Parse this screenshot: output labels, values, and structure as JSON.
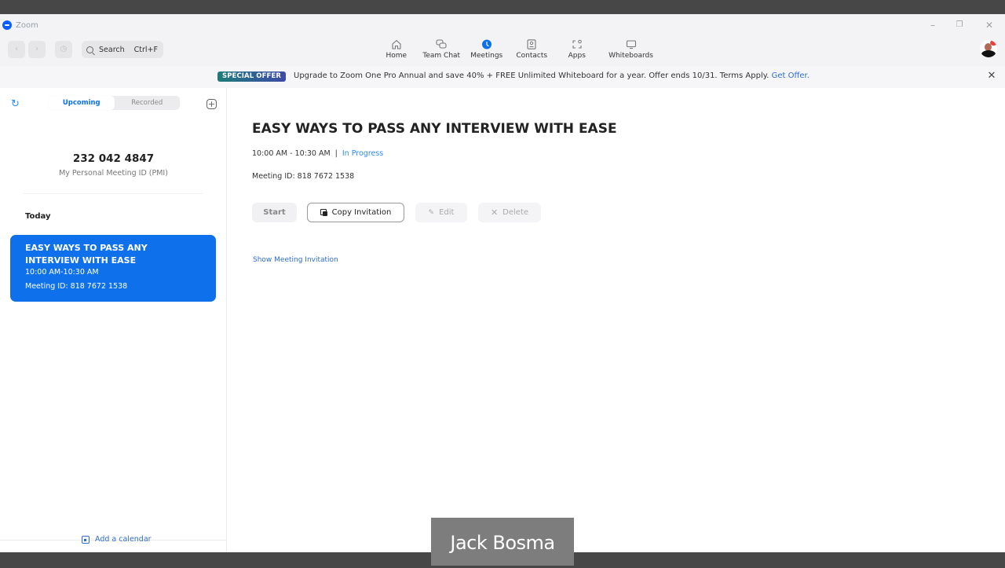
{
  "window": {
    "title": "Zoom",
    "controls": {
      "minimize": "–",
      "restore": "❐",
      "close": "✕"
    }
  },
  "toolbar": {
    "back_icon": "‹",
    "forward_icon": "›",
    "history_icon": "◷",
    "search_label": "Search",
    "search_shortcut": "Ctrl+F"
  },
  "nav": {
    "items": [
      {
        "label": "Home",
        "icon": "home-icon",
        "active": false
      },
      {
        "label": "Team Chat",
        "icon": "chat-icon",
        "active": false
      },
      {
        "label": "Meetings",
        "icon": "clock-icon",
        "active": true
      },
      {
        "label": "Contacts",
        "icon": "contacts-icon",
        "active": false
      },
      {
        "label": "Apps",
        "icon": "apps-icon",
        "active": false
      },
      {
        "label": "Whiteboards",
        "icon": "whiteboard-icon",
        "active": false
      }
    ]
  },
  "banner": {
    "tag": "SPECIAL OFFER",
    "text": "Upgrade to Zoom One Pro Annual and save 40% + FREE Unlimited Whiteboard for a year. Offer ends 10/31.  Terms Apply. ",
    "link": "Get Offer.",
    "close": "✕"
  },
  "sidebar": {
    "refresh_icon": "↻",
    "tabs": [
      {
        "label": "Upcoming",
        "active": true
      },
      {
        "label": "Recorded",
        "active": false
      }
    ],
    "add_icon": "+",
    "pmi_number": "232 042 4847",
    "pmi_label": "My Personal Meeting ID (PMI)",
    "section_label": "Today",
    "meetings": [
      {
        "title": "EASY WAYS TO PASS ANY INTERVIEW WITH EASE",
        "time": "10:00 AM-10:30 AM",
        "meeting_id": "Meeting ID: 818 7672 1538",
        "selected": true
      }
    ],
    "add_calendar": "Add a calendar"
  },
  "main": {
    "title": "EASY WAYS TO PASS ANY INTERVIEW WITH EASE",
    "time": "10:00 AM - 10:30 AM",
    "separator": "|",
    "status": "In Progress",
    "meeting_id": "Meeting ID: 818 7672 1538",
    "buttons": {
      "start": "Start",
      "copy": "Copy Invitation",
      "edit": "Edit",
      "delete": "Delete"
    },
    "show_invitation": "Show Meeting Invitation"
  },
  "overlay": {
    "speaker_name": "Jack Bosma"
  },
  "colors": {
    "accent": "#0e71eb",
    "link": "#2d6cd6",
    "status": "#2d8cff"
  }
}
